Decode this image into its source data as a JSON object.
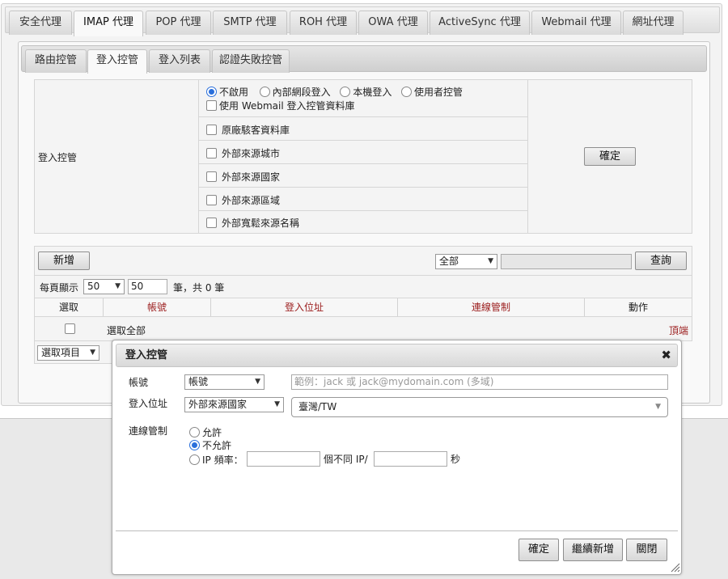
{
  "top_tabs": [
    "安全代理",
    "IMAP 代理",
    "POP 代理",
    "SMTP 代理",
    "ROH 代理",
    "OWA 代理",
    "ActiveSync 代理",
    "Webmail 代理",
    "網址代理"
  ],
  "sub_tabs": [
    "路由控管",
    "登入控管",
    "登入列表",
    "認證失敗控管"
  ],
  "settings": {
    "row_label": "登入控管",
    "radios": [
      "不啟用",
      "內部網段登入",
      "本機登入",
      "使用者控管"
    ],
    "webmail_db": "使用 Webmail 登入控管資料庫",
    "checks": [
      "原廠駭客資料庫",
      "外部來源城市",
      "外部來源國家",
      "外部來源區域",
      "外部寬鬆來源名稱"
    ],
    "confirm": "確定"
  },
  "toolbar": {
    "add": "新增",
    "filter_value": "全部",
    "search_value": "",
    "query": "查詢",
    "per_page_label": "每頁顯示",
    "per_page_value": "50",
    "per_page_input": "50",
    "count_text": "筆，共 0 筆"
  },
  "table": {
    "headers": [
      "選取",
      "帳號",
      "登入位址",
      "連線管制",
      "動作"
    ],
    "select_all": "選取全部",
    "top_link": "頂端",
    "select_items": "選取項目"
  },
  "dialog": {
    "title": "登入控管",
    "account_label": "帳號",
    "account_select": "帳號",
    "account_placeholder": "範例：jack 或 jack@mydomain.com (多域)",
    "location_label": "登入位址",
    "location_select": "外部來源國家",
    "location_value": "臺灣/TW",
    "control_label": "連線管制",
    "allow": "允許",
    "deny": "不允許",
    "ip_rate": "IP 頻率：",
    "ip_mid": "個不同 IP/",
    "ip_unit": "秒",
    "ok": "確定",
    "continue_add": "繼續新增",
    "close": "關閉"
  },
  "icons": {
    "close": "close-icon",
    "resize": "resize-grip-icon",
    "dropdown": "chevron-down-icon"
  }
}
